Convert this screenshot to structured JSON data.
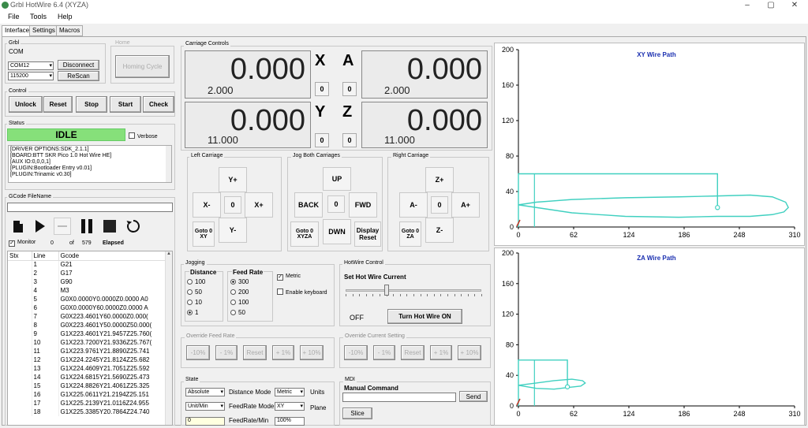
{
  "window": {
    "title": "Grbl HotWire 6.4 (XYZA)",
    "minimize": "–",
    "maximize": "▢",
    "close": "✕"
  },
  "menu": [
    "File",
    "Tools",
    "Help"
  ],
  "tabs": [
    "Interface",
    "Settings",
    "Macros"
  ],
  "grbl": {
    "group": "Grbl",
    "com_label": "COM",
    "port": "COM12",
    "baud": "115200",
    "disconnect": "Disconnect",
    "rescan": "ReScan"
  },
  "home": {
    "group": "Home",
    "homing_cycle": "Homing Cycle"
  },
  "control": {
    "group": "Control",
    "buttons": [
      "Unlock",
      "Reset",
      "Stop",
      "Start",
      "Check"
    ]
  },
  "status": {
    "group": "Status",
    "state": "IDLE",
    "verbose": "Verbose",
    "log": [
      "[DRIVER OPTIONS:SDK_2.1.1]",
      "[BOARD:BTT SKR Pico 1.0 Hot Wire HE]",
      "[AUX IO:0,0,0,1]",
      "[PLUGIN:Bootloader Entry v0.01]",
      "[PLUGIN:Trinamic v0.30]"
    ]
  },
  "gcode": {
    "file_label": "GCode FileName",
    "monitor": "Monitor",
    "current": "0",
    "of": "of",
    "total": "579",
    "elapsed": "Elapsed",
    "headers": [
      "Stx",
      "Line",
      "Gcode"
    ],
    "rows": [
      [
        "",
        "1",
        "G21"
      ],
      [
        "",
        "2",
        "G17"
      ],
      [
        "",
        "3",
        "G90"
      ],
      [
        "",
        "4",
        "M3"
      ],
      [
        "",
        "5",
        "G0X0.0000Y0.0000Z0.0000 A0"
      ],
      [
        "",
        "6",
        "G0X0.0000Y60.0000Z0.0000 A"
      ],
      [
        "",
        "7",
        "G0X223.4601Y60.0000Z0.000("
      ],
      [
        "",
        "8",
        "G0X223.4601Y50.0000Z50.000("
      ],
      [
        "",
        "9",
        "G1X223.4601Y21.9457Z25.760("
      ],
      [
        "",
        "10",
        "G1X223.7200Y21.9336Z25.767("
      ],
      [
        "",
        "11",
        "G1X223.9761Y21.8890Z25.741"
      ],
      [
        "",
        "12",
        "G1X224.2245Y21.8124Z25.682"
      ],
      [
        "",
        "13",
        "G1X224.4609Y21.7051Z25.592"
      ],
      [
        "",
        "14",
        "G1X224.6815Y21.5690Z25.473"
      ],
      [
        "",
        "15",
        "G1X224.8826Y21.4061Z25.325"
      ],
      [
        "",
        "16",
        "G1X225.0611Y21.2194Z25.151"
      ],
      [
        "",
        "17",
        "G1X225.2139Y21.0116Z24.955"
      ],
      [
        "",
        "18",
        "G1X225.3385Y20.7864Z24.740"
      ]
    ]
  },
  "carriage": {
    "group": "Carriage Controls",
    "x": {
      "letter": "X",
      "value": "0.000",
      "sub": "2.000",
      "zero": "0"
    },
    "a": {
      "letter": "A",
      "value": "0.000",
      "sub": "2.000",
      "zero": "0"
    },
    "y": {
      "letter": "Y",
      "value": "0.000",
      "sub": "11.000",
      "zero": "0"
    },
    "z": {
      "letter": "Z",
      "value": "0.000",
      "sub": "11.000",
      "zero": "0"
    }
  },
  "left_carriage": {
    "group": "Left Carriage",
    "yplus": "Y+",
    "xminus": "X-",
    "zero": "0",
    "xplus": "X+",
    "goto0": "Goto 0",
    "xy": "XY",
    "yminus": "Y-"
  },
  "jog_both": {
    "group": "Jog Both Carriages",
    "up": "UP",
    "back": "BACK",
    "zero": "0",
    "fwd": "FWD",
    "goto0": "Goto 0",
    "xyza": "XYZA",
    "dwn": "DWN",
    "display_reset": "Display Reset"
  },
  "right_carriage": {
    "group": "Right Carriage",
    "zplus": "Z+",
    "aminus": "A-",
    "zero": "0",
    "aplus": "A+",
    "goto0": "Goto 0",
    "za": "ZA",
    "zminus": "Z-"
  },
  "jogging": {
    "group": "Jogging",
    "distance": "Distance",
    "distances": [
      "100",
      "50",
      "10",
      "1"
    ],
    "distance_selected": 3,
    "feed": "Feed Rate",
    "feeds": [
      "300",
      "200",
      "100",
      "50"
    ],
    "feed_selected": 0,
    "metric": "Metric",
    "metric_checked": true,
    "enable_keyboard": "Enable keyboard"
  },
  "hotwire": {
    "group": "HotWire Control",
    "set_current": "Set Hot Wire Current",
    "state": "OFF",
    "turn_on": "Turn Hot Wire ON",
    "slider_level": 0.3
  },
  "override_feed": {
    "group": "Override Feed Rate",
    "buttons": [
      "-10%",
      "- 1%",
      "Reset",
      "+ 1%",
      "+ 10%"
    ]
  },
  "override_current": {
    "group": "Override Current Setting",
    "buttons": [
      "-10%",
      "- 1%",
      "Reset",
      "+ 1%",
      "+ 10%"
    ]
  },
  "state": {
    "group": "State",
    "distance_mode_value": "Absolute",
    "distance_mode_label": "Distance Mode",
    "units_value": "Metric",
    "units_label": "Units",
    "feedrate_mode_value": "Unit/Min",
    "feedrate_mode_label": "FeedRate Mode",
    "plane_value": "XY",
    "plane_label": "Plane",
    "feedrate_value": "0",
    "feedrate_label": "FeedRate/Min",
    "override_value": "100%"
  },
  "mdi": {
    "group": "MDI",
    "manual_command": "Manual Command",
    "send": "Send",
    "slice": "Slice"
  },
  "chart_data": [
    {
      "type": "line",
      "title": "XY Wire Path",
      "xlim": [
        0,
        310
      ],
      "ylim": [
        0,
        200
      ],
      "xticks": [
        "0",
        "62",
        "124",
        "186",
        "248",
        "310"
      ],
      "yticks": [
        "0",
        "40",
        "80",
        "120",
        "160",
        "200"
      ],
      "color": "#40d0c0",
      "rect": [
        [
          0,
          0
        ],
        [
          0,
          60
        ],
        [
          223.46,
          60
        ],
        [
          223.46,
          21.95
        ]
      ],
      "post": [
        [
          18,
          0
        ],
        [
          18,
          60
        ]
      ],
      "airfoil_upper": [
        [
          0,
          25
        ],
        [
          20,
          28
        ],
        [
          60,
          31
        ],
        [
          120,
          33
        ],
        [
          180,
          34
        ],
        [
          223,
          35
        ],
        [
          260,
          36
        ],
        [
          285,
          34
        ],
        [
          300,
          28
        ],
        [
          303,
          22
        ],
        [
          298,
          17
        ],
        [
          285,
          14
        ],
        [
          260,
          12
        ],
        [
          223,
          12
        ],
        [
          180,
          11
        ],
        [
          120,
          12
        ],
        [
          60,
          16
        ],
        [
          20,
          22
        ],
        [
          0,
          25
        ]
      ],
      "point": [
        223.46,
        21.95
      ]
    },
    {
      "type": "line",
      "title": "ZA Wire Path",
      "xlim": [
        0,
        310
      ],
      "ylim": [
        0,
        200
      ],
      "xticks": [
        "0",
        "62",
        "124",
        "186",
        "248",
        "310"
      ],
      "yticks": [
        "0",
        "40",
        "80",
        "120",
        "160",
        "200"
      ],
      "color": "#40d0c0",
      "rect": [
        [
          0,
          0
        ],
        [
          0,
          60
        ],
        [
          55,
          60
        ],
        [
          55,
          25
        ]
      ],
      "post": [
        [
          18,
          0
        ],
        [
          18,
          60
        ]
      ],
      "airfoil_upper": [
        [
          0,
          27
        ],
        [
          20,
          30
        ],
        [
          40,
          33
        ],
        [
          60,
          35
        ],
        [
          72,
          33
        ],
        [
          75,
          30
        ],
        [
          70,
          26
        ],
        [
          55,
          24
        ],
        [
          40,
          22
        ],
        [
          20,
          23
        ],
        [
          0,
          27
        ]
      ],
      "point": [
        55,
        25
      ]
    }
  ]
}
